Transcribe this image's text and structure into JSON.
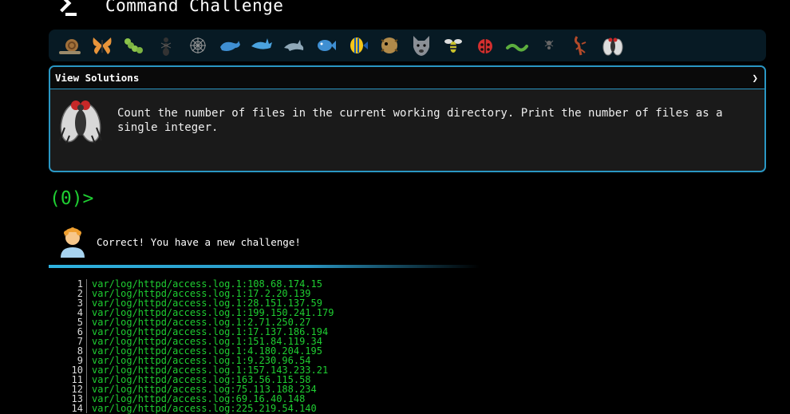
{
  "header": {
    "title": "Command Challenge",
    "logo_icon": "terminal-prompt-icon"
  },
  "icon_bar": {
    "items": [
      {
        "name": "snail-icon"
      },
      {
        "name": "butterfly-icon"
      },
      {
        "name": "caterpillar-icon"
      },
      {
        "name": "ant-icon"
      },
      {
        "name": "spider-web-icon"
      },
      {
        "name": "whale-icon"
      },
      {
        "name": "shark-icon"
      },
      {
        "name": "dolphin-icon"
      },
      {
        "name": "fish-icon"
      },
      {
        "name": "tropical-fish-icon"
      },
      {
        "name": "blowfish-icon"
      },
      {
        "name": "wolf-icon"
      },
      {
        "name": "bee-icon"
      },
      {
        "name": "lady-beetle-icon"
      },
      {
        "name": "worm-icon"
      },
      {
        "name": "spider-icon"
      },
      {
        "name": "scorpion-icon"
      },
      {
        "name": "fly-icon"
      }
    ]
  },
  "challenge": {
    "toggle_label": "View Solutions",
    "toggle_arrow": "❯",
    "description": "Count the number of files in the current working directory. Print the number of files as a single integer.",
    "icon": "fly-icon"
  },
  "prompt": {
    "text": "(0)>"
  },
  "feedback": {
    "message": "Correct! You have a new challenge!",
    "avatar": "person-avatar-icon"
  },
  "output": {
    "lines": [
      {
        "n": "1",
        "text": "var/log/httpd/access.log.1:108.68.174.15"
      },
      {
        "n": "2",
        "text": "var/log/httpd/access.log.1:17.2.20.139"
      },
      {
        "n": "3",
        "text": "var/log/httpd/access.log.1:28.151.137.59"
      },
      {
        "n": "4",
        "text": "var/log/httpd/access.log.1:199.150.241.179"
      },
      {
        "n": "5",
        "text": "var/log/httpd/access.log.1:2.71.250.27"
      },
      {
        "n": "6",
        "text": "var/log/httpd/access.log.1:17.137.186.194"
      },
      {
        "n": "7",
        "text": "var/log/httpd/access.log.1:151.84.119.34"
      },
      {
        "n": "8",
        "text": "var/log/httpd/access.log.1:4.180.204.195"
      },
      {
        "n": "9",
        "text": "var/log/httpd/access.log.1:9.230.96.54"
      },
      {
        "n": "10",
        "text": "var/log/httpd/access.log.1:157.143.233.21"
      },
      {
        "n": "11",
        "text": "var/log/httpd/access.log:163.56.115.58"
      },
      {
        "n": "12",
        "text": "var/log/httpd/access.log:75.113.188.234"
      },
      {
        "n": "13",
        "text": "var/log/httpd/access.log:69.16.40.148"
      },
      {
        "n": "14",
        "text": "var/log/httpd/access.log:225.219.54.140"
      }
    ]
  },
  "colors": {
    "accent": "#2a97c4",
    "terminal_green": "#1fce32",
    "panel_bg": "#1a1a1a",
    "iconbar_bg": "#071a24"
  }
}
